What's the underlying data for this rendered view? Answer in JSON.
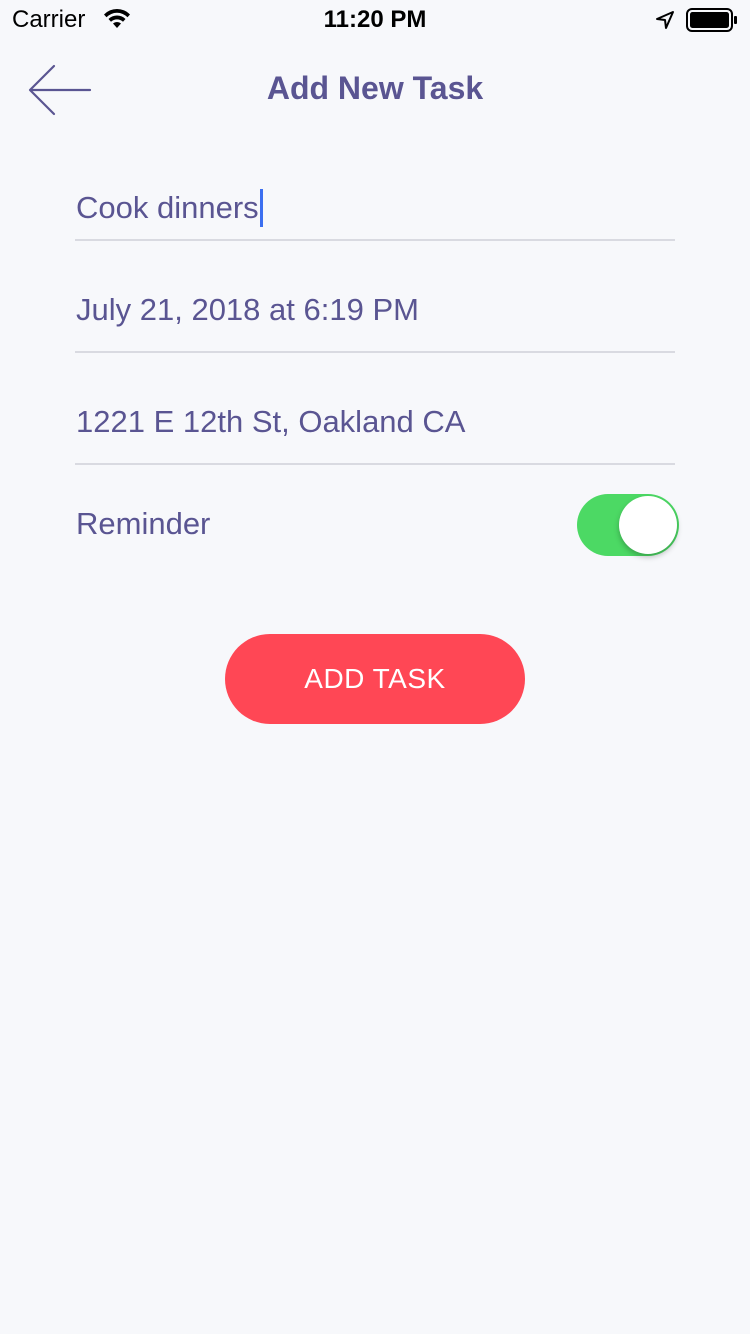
{
  "status_bar": {
    "carrier": "Carrier",
    "time": "11:20 PM",
    "icons": [
      "wifi-icon",
      "location-arrow-icon",
      "battery-icon"
    ]
  },
  "nav": {
    "back_icon": "arrow-left-icon",
    "title": "Add New Task"
  },
  "form": {
    "task_name": "Cook dinners",
    "date": "July 21, 2018 at 6:19 PM",
    "location": "1221 E 12th St, Oakland CA",
    "reminder_label": "Reminder",
    "reminder_on": true
  },
  "actions": {
    "add_label": "ADD TASK"
  },
  "colors": {
    "background": "#f7f8fb",
    "text": "#5a5592",
    "divider": "#d9dae1",
    "toggle_on": "#4cd964",
    "button": "#ff4755",
    "caret": "#3c6ff0"
  }
}
